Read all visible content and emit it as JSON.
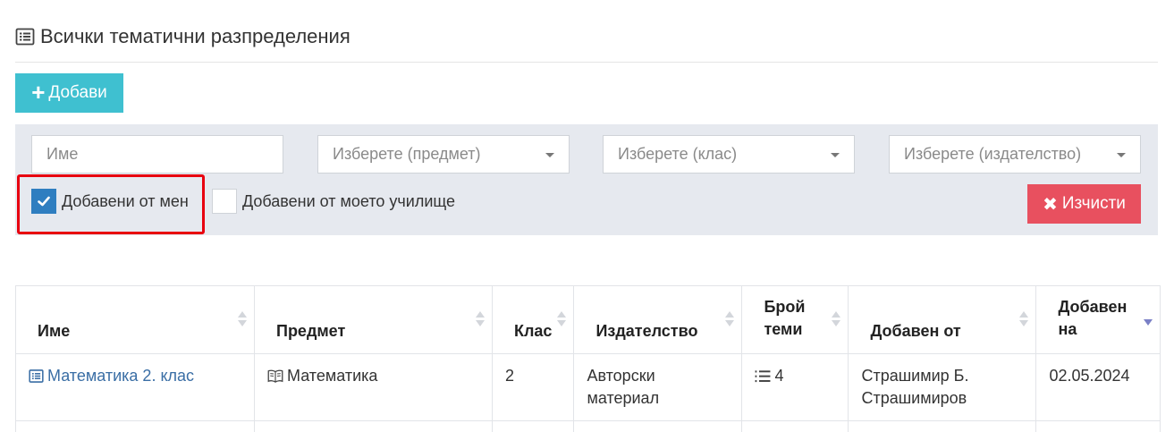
{
  "page": {
    "title": "Всички тематични разпределения",
    "title_icon": "list-alt-icon"
  },
  "toolbar": {
    "add_label": "Добави",
    "add_icon": "plus-icon"
  },
  "filters": {
    "name_placeholder": "Име",
    "subject_placeholder": "Изберете (предмет)",
    "class_placeholder": "Изберете (клас)",
    "publisher_placeholder": "Изберете (издателство)",
    "added_by_me_label": "Добавени от мен",
    "added_by_me_checked": true,
    "added_by_school_label": "Добавени от моето училище",
    "added_by_school_checked": false,
    "clear_label": "Изчисти",
    "clear_icon": "times-icon"
  },
  "colors": {
    "add_button": "#3fc0d0",
    "clear_button": "#e8505f",
    "checkbox_checked": "#2f7ec0",
    "highlight": "#e8000f",
    "link": "#3a6ea5"
  },
  "table": {
    "columns": [
      "Име",
      "Предмет",
      "Клас",
      "Издателство",
      "Брой теми",
      "Добавен от",
      "Добавен на"
    ],
    "sorted_column": "Добавен на",
    "sort_direction": "desc",
    "rows": [
      {
        "name": "Математика 2. клас",
        "subject": "Математика",
        "class": "2",
        "publisher": "Авторски материал",
        "topics": "4",
        "added_by": "Страшимир Б. Страшимиров",
        "added_on": "02.05.2024"
      }
    ]
  }
}
